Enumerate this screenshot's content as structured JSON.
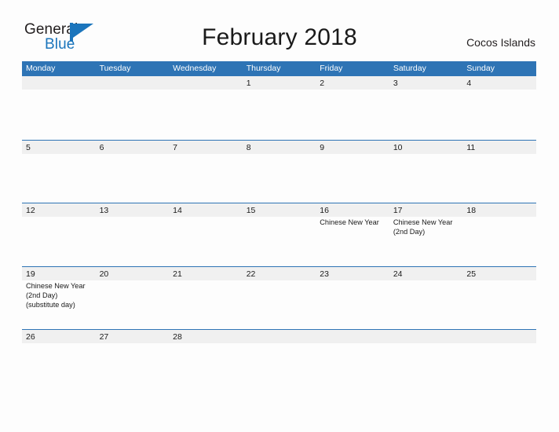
{
  "brand": {
    "name_part1": "General",
    "name_part2": "Blue",
    "color_dark": "#231F20",
    "color_blue": "#1B75BC",
    "flag_icon": "blue-flag-logo-icon"
  },
  "header": {
    "title": "February 2018",
    "location": "Cocos Islands"
  },
  "theme": {
    "header_blue": "#2E74B5",
    "band_gray": "#F0F0F0",
    "text_dark": "#1A1A1A",
    "page_background": "#FDFDFD"
  },
  "calendar": {
    "weekday_headers": [
      "Monday",
      "Tuesday",
      "Wednesday",
      "Thursday",
      "Friday",
      "Saturday",
      "Sunday"
    ],
    "weeks": [
      [
        {
          "day": "",
          "events": []
        },
        {
          "day": "",
          "events": []
        },
        {
          "day": "",
          "events": []
        },
        {
          "day": "1",
          "events": []
        },
        {
          "day": "2",
          "events": []
        },
        {
          "day": "3",
          "events": []
        },
        {
          "day": "4",
          "events": []
        }
      ],
      [
        {
          "day": "5",
          "events": []
        },
        {
          "day": "6",
          "events": []
        },
        {
          "day": "7",
          "events": []
        },
        {
          "day": "8",
          "events": []
        },
        {
          "day": "9",
          "events": []
        },
        {
          "day": "10",
          "events": []
        },
        {
          "day": "11",
          "events": []
        }
      ],
      [
        {
          "day": "12",
          "events": []
        },
        {
          "day": "13",
          "events": []
        },
        {
          "day": "14",
          "events": []
        },
        {
          "day": "15",
          "events": []
        },
        {
          "day": "16",
          "events": [
            "Chinese New Year"
          ]
        },
        {
          "day": "17",
          "events": [
            "Chinese New Year",
            "(2nd Day)"
          ]
        },
        {
          "day": "18",
          "events": []
        }
      ],
      [
        {
          "day": "19",
          "events": [
            "Chinese New Year",
            "(2nd Day)",
            "(substitute day)"
          ]
        },
        {
          "day": "20",
          "events": []
        },
        {
          "day": "21",
          "events": []
        },
        {
          "day": "22",
          "events": []
        },
        {
          "day": "23",
          "events": []
        },
        {
          "day": "24",
          "events": []
        },
        {
          "day": "25",
          "events": []
        }
      ],
      [
        {
          "day": "26",
          "events": []
        },
        {
          "day": "27",
          "events": []
        },
        {
          "day": "28",
          "events": []
        },
        {
          "day": "",
          "events": []
        },
        {
          "day": "",
          "events": []
        },
        {
          "day": "",
          "events": []
        },
        {
          "day": "",
          "events": []
        }
      ]
    ]
  }
}
